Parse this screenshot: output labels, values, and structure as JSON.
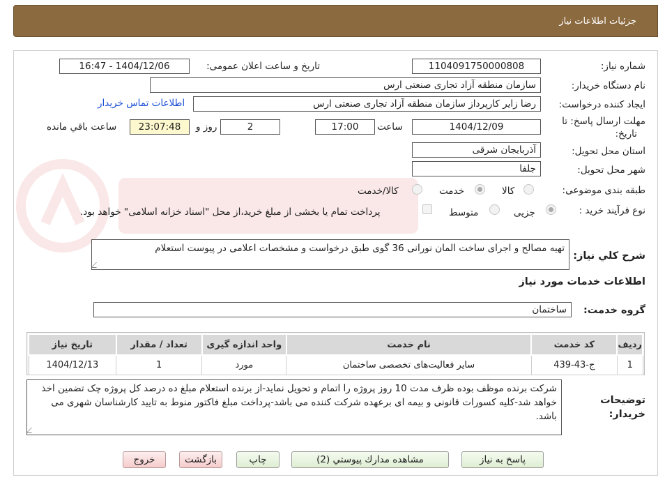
{
  "header": {
    "title": "جزئیات اطلاعات نیاز"
  },
  "form": {
    "need_number_label": "شماره نیاز:",
    "need_number": "1104091750000808",
    "announce_label": "تاریخ و ساعت اعلان عمومی:",
    "announce_value": "1404/12/06 - 16:47",
    "buyer_org_label": "نام دستگاه خریدار:",
    "buyer_org": "سازمان منطقه آزاد تجاری صنعتی ارس",
    "requester_label": "ایجاد کننده درخواست:",
    "requester": "رضا زایر کارپرداز سازمان منطقه آزاد تجاری صنعتی ارس",
    "contact_link": "اطلاعات تماس خریدار",
    "deadline_label_1": "مهلت ارسال پاسخ: تا",
    "deadline_label_2": "تاریخ:",
    "deadline_date": "1404/12/09",
    "time_label": "ساعت",
    "deadline_time": "17:00",
    "days_value": "2",
    "days_label": "روز و",
    "remaining_time": "23:07:48",
    "remaining_label": "ساعت باقي مانده",
    "province_label": "استان محل تحویل:",
    "province": "آذربایجان شرقی",
    "city_label": "شهر محل تحویل:",
    "city": "جلفا",
    "category_label": "طبقه بندی موضوعی:",
    "category_options": [
      "کالا",
      "خدمت",
      "کالا/خدمت"
    ],
    "process_label": "نوع فرآیند خرید :",
    "process_options": [
      "جزیی",
      "متوسط"
    ],
    "payment_note": "پرداخت تمام یا بخشی از مبلغ خرید،از محل \"اسناد خزانه اسلامی\" خواهد بود.",
    "summary_label": "شرح کلي نياز:",
    "summary": "تهیه مصالح و اجرای ساخت المان نورانی 36 گوی طبق درخواست و مشخصات اعلامی در پیوست استعلام"
  },
  "services": {
    "section_title": "اطلاعات خدمات مورد نياز",
    "group_label": "گروه خدمت:",
    "group_value": "ساختمان",
    "columns": [
      "رديف",
      "كد خدمت",
      "نام خدمت",
      "واحد اندازه گیری",
      "تعداد / مقدار",
      "تاریخ نیاز"
    ],
    "rows": [
      [
        "1",
        "ج-43-439",
        "سایر فعالیت‌های تخصصی ساختمان",
        "مورد",
        "1",
        "1404/12/13"
      ]
    ]
  },
  "buyer_notes": {
    "label_1": "توضيحات",
    "label_2": "خريدار:",
    "text": "شرکت برنده موظف بوده ظرف مدت 10 روز پروژه را اتمام و تحویل نماید-از برنده استعلام مبلغ ده درصد کل پروژه چک تضمین اخذ خواهد شد-کلیه کسورات قانونی و بیمه ای برعهده شرکت کننده می باشد-پرداخت مبلغ فاکتور منوط به تایید کارشناسان شهری می باشد."
  },
  "buttons": {
    "reply": "پاسخ به نياز",
    "attachments": "مشاهده مدارك پيوستي (2)",
    "print": "چاپ",
    "back": "بازگشت",
    "exit": "خروج"
  },
  "colors": {
    "header_bg": "#8b6a3f",
    "link": "#1a4fd6",
    "timer_bg": "#fdf8cd"
  }
}
